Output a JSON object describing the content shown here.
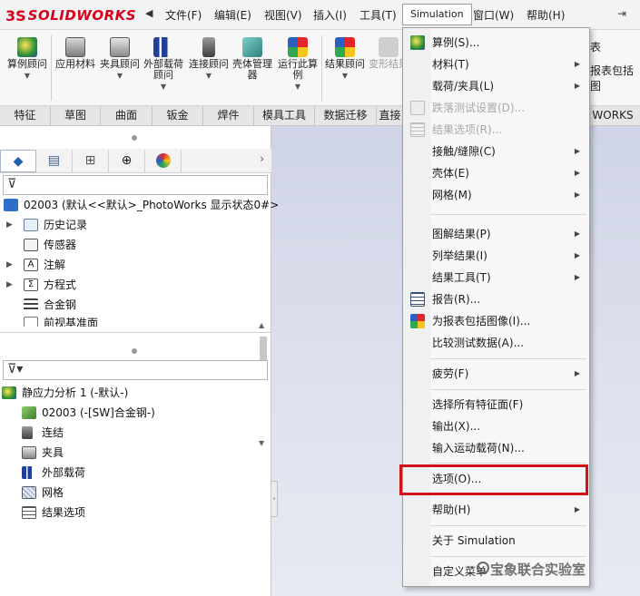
{
  "menubar": {
    "logo_mark": "3S",
    "logo_text": "SOLIDWORKS",
    "items": [
      "文件(F)",
      "编辑(E)",
      "视图(V)",
      "插入(I)",
      "工具(T)",
      "Simulation",
      "窗口(W)",
      "帮助(H)"
    ]
  },
  "toolbar": {
    "buttons": [
      {
        "label": "算例顾问",
        "icon": "study-advisor-icon"
      },
      {
        "label": "应用材料",
        "icon": "apply-material-icon"
      },
      {
        "label": "夹具顾问",
        "icon": "fixtures-advisor-icon"
      },
      {
        "label": "外部载荷顾问",
        "icon": "external-loads-icon"
      },
      {
        "label": "连接顾问",
        "icon": "connections-advisor-icon"
      },
      {
        "label": "壳体管理器",
        "icon": "shell-manager-icon"
      },
      {
        "label": "运行此算例",
        "icon": "run-study-icon"
      },
      {
        "label": "结果顾问",
        "icon": "results-advisor-icon"
      },
      {
        "label": "变形结果",
        "icon": "deformed-result-icon"
      }
    ],
    "right_fragments": [
      "表",
      "报表包括图"
    ]
  },
  "command_tabs": [
    "特征",
    "草图",
    "曲面",
    "钣金",
    "焊件",
    "模具工具",
    "数据迁移",
    "直接",
    "WORKS 插件"
  ],
  "panel": {
    "tabs": [
      "feature-manager-icon",
      "property-manager-icon",
      "configuration-manager-icon",
      "dimxpert-icon",
      "display-manager-icon"
    ],
    "root": "02003  (默认<<默认>_PhotoWorks 显示状态0#>",
    "items": [
      "历史记录",
      "传感器",
      "注解",
      "方程式",
      "合金钢",
      "前视基准面"
    ],
    "study_root": "静应力分析 1 (-默认-)",
    "study_items": [
      "02003 (-[SW]合金钢-)",
      "连结",
      "夹具",
      "外部载荷",
      "网格",
      "结果选项"
    ]
  },
  "dropdown": {
    "items": [
      {
        "label": "算例(S)...",
        "submenu": false,
        "disabled": false,
        "icon": "study-icon"
      },
      {
        "label": "材料(T)",
        "submenu": true,
        "disabled": false,
        "icon": ""
      },
      {
        "label": "载荷/夹具(L)",
        "submenu": true,
        "disabled": false,
        "icon": ""
      },
      {
        "label": "跌落测试设置(D)...",
        "submenu": false,
        "disabled": true,
        "icon": "drop-test-icon"
      },
      {
        "label": "结果选项(R)...",
        "submenu": false,
        "disabled": true,
        "icon": "result-options-icon"
      },
      {
        "label": "接触/缝隙(C)",
        "submenu": true,
        "disabled": false,
        "icon": ""
      },
      {
        "label": "壳体(E)",
        "submenu": true,
        "disabled": false,
        "icon": ""
      },
      {
        "label": "网格(M)",
        "submenu": true,
        "disabled": false,
        "icon": ""
      },
      {
        "label": "图解结果(P)",
        "submenu": true,
        "disabled": false,
        "icon": ""
      },
      {
        "label": "列举结果(I)",
        "submenu": true,
        "disabled": false,
        "icon": ""
      },
      {
        "label": "结果工具(T)",
        "submenu": true,
        "disabled": false,
        "icon": ""
      },
      {
        "label": "报告(R)...",
        "submenu": false,
        "disabled": false,
        "icon": "report-icon"
      },
      {
        "label": "为报表包括图像(I)...",
        "submenu": false,
        "disabled": false,
        "icon": "include-image-icon"
      },
      {
        "label": "比较测试数据(A)...",
        "submenu": false,
        "disabled": false,
        "icon": ""
      },
      {
        "label": "疲劳(F)",
        "submenu": true,
        "disabled": false,
        "icon": ""
      },
      {
        "label": "选择所有特征面(F)",
        "submenu": false,
        "disabled": false,
        "icon": ""
      },
      {
        "label": "输出(X)...",
        "submenu": false,
        "disabled": false,
        "icon": ""
      },
      {
        "label": "输入运动载荷(N)...",
        "submenu": false,
        "disabled": false,
        "icon": ""
      },
      {
        "label": "选项(O)...",
        "submenu": false,
        "disabled": false,
        "icon": ""
      },
      {
        "label": "帮助(H)",
        "submenu": true,
        "disabled": false,
        "icon": ""
      },
      {
        "label": "关于 Simulation",
        "submenu": false,
        "disabled": false,
        "icon": ""
      },
      {
        "label": "自定义菜单",
        "submenu": false,
        "disabled": false,
        "icon": ""
      }
    ]
  },
  "watermark": "宝象联合实验室",
  "colors": {
    "brand_red": "#d6001c",
    "highlight_red": "#d0121b"
  }
}
